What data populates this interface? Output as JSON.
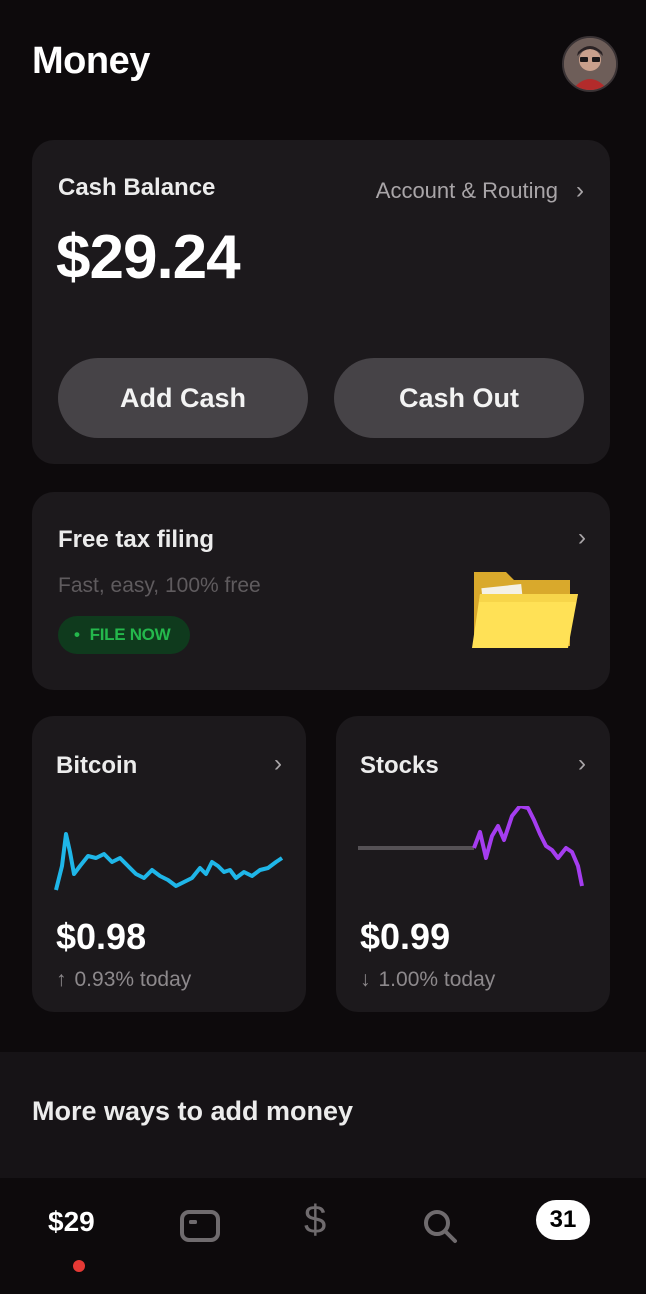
{
  "header": {
    "title": "Money"
  },
  "balance": {
    "label": "Cash Balance",
    "routing_label": "Account & Routing",
    "amount": "$29.24",
    "add_cash_label": "Add Cash",
    "cash_out_label": "Cash Out"
  },
  "tax": {
    "title": "Free tax filing",
    "subtitle": "Fast, easy, 100% free",
    "badge": "FILE NOW"
  },
  "bitcoin": {
    "title": "Bitcoin",
    "amount": "$0.98",
    "change": "0.93% today",
    "direction_icon": "arrow-up-icon",
    "color": "#1fb6e8"
  },
  "stocks": {
    "title": "Stocks",
    "amount": "$0.99",
    "change": "1.00% today",
    "direction_icon": "arrow-down-icon",
    "color": "#a53df0"
  },
  "more": {
    "title": "More ways to add money"
  },
  "tabbar": {
    "money_label": "$29",
    "card_icon": "card-icon",
    "pay_label": "$",
    "search_icon": "search-icon",
    "activity_count": "31"
  },
  "colors": {
    "background": "#0d0a0c",
    "card": "#1c191c",
    "button": "#464347",
    "badge_bg": "#0f3a1d",
    "badge_fg": "#24b84c",
    "notification_dot": "#e53935"
  }
}
